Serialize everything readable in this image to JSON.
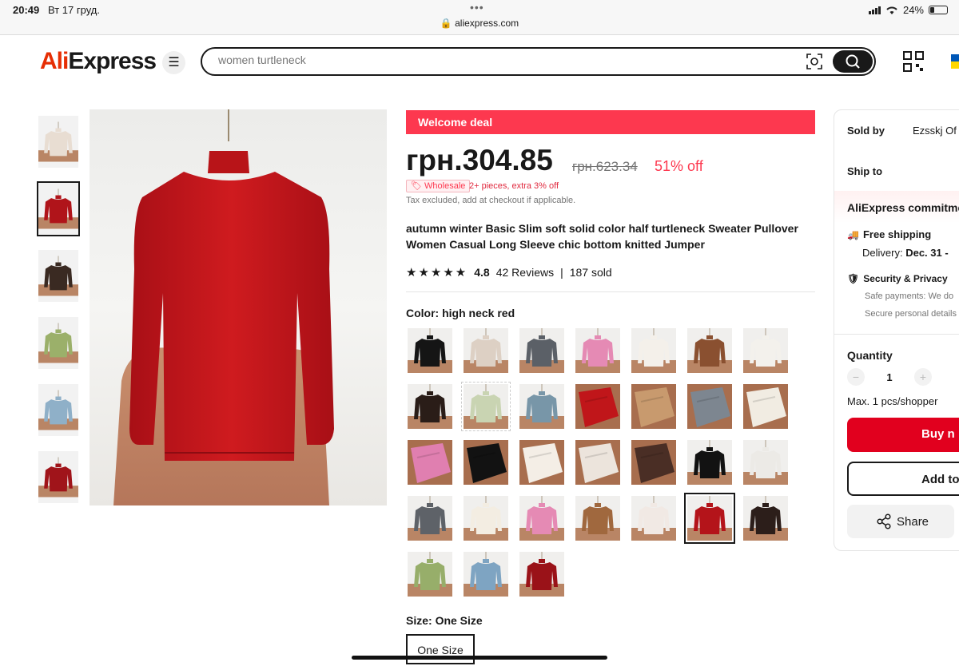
{
  "status_bar": {
    "time": "20:49",
    "date": "Вт 17 груд.",
    "dots": "•••",
    "url": "aliexpress.com",
    "battery": "24%",
    "battery_level": 0.24
  },
  "header": {
    "logo_part1": "Ali",
    "logo_part2": "Express",
    "search_placeholder": "women turtleneck"
  },
  "product": {
    "welcome_deal": "Welcome deal",
    "price": "грн.304.85",
    "old_price": "грн.623.34",
    "discount": "51% off",
    "wholesale_badge": "Wholesale",
    "wholesale_text": "2+ pieces, extra 3% off",
    "tax_note": "Tax excluded, add at checkout if applicable.",
    "title": "autumn winter Basic Slim soft solid color half turtleneck Sweater Pullover Women Casual Long Sleeve chic bottom knitted Jumper",
    "stars": "★★★★★",
    "rating": "4.8",
    "reviews": "42 Reviews",
    "sep": "|",
    "sold": "187 sold",
    "color_label": "Color: high neck red",
    "size_label": "Size: One Size",
    "size_option": "One Size"
  },
  "thumbnails": [
    {
      "color": "#e8ddd2"
    },
    {
      "color": "#b0141a",
      "selected": true
    },
    {
      "color": "#3a2a22"
    },
    {
      "color": "#9bb06a"
    },
    {
      "color": "#8fb0c8"
    },
    {
      "color": "#a0141a"
    }
  ],
  "swatches": [
    {
      "color": "#151515"
    },
    {
      "color": "#ddd0c4"
    },
    {
      "color": "#5b6067"
    },
    {
      "color": "#e58ab4"
    },
    {
      "color": "#f4f0ea"
    },
    {
      "color": "#8a5030"
    },
    {
      "color": "#f3f1ec"
    },
    {
      "color": "#2a1d18"
    },
    {
      "color": "#c9d4b2",
      "dashed": true
    },
    {
      "color": "#7896a8"
    },
    {
      "color": "#c0161a",
      "folded": true
    },
    {
      "color": "#c89a6e",
      "folded": true
    },
    {
      "color": "#7d8690",
      "folded": true
    },
    {
      "color": "#f1ece2",
      "folded": true
    },
    {
      "color": "#e07fb0",
      "folded": true
    },
    {
      "color": "#121212",
      "folded": true
    },
    {
      "color": "#f4eee6",
      "folded": true
    },
    {
      "color": "#ece4dc",
      "folded": true
    },
    {
      "color": "#4a2e25",
      "folded": true
    },
    {
      "color": "#121212"
    },
    {
      "color": "#eceae6"
    },
    {
      "color": "#5e6268"
    },
    {
      "color": "#f3ede2"
    },
    {
      "color": "#e58ab4"
    },
    {
      "color": "#a0683e"
    },
    {
      "color": "#f1e9e4"
    },
    {
      "color": "#b4141a",
      "selected": true
    },
    {
      "color": "#2c1e1a"
    },
    {
      "color": "#97ae6a"
    },
    {
      "color": "#7ea4c2"
    },
    {
      "color": "#9a1218"
    }
  ],
  "sidebar": {
    "sold_by_label": "Sold by",
    "sold_by_value": "Ezsskj Of",
    "ship_to_label": "Ship to",
    "commitment": "AliExpress commitme",
    "free_shipping": "Free shipping",
    "delivery_label": "Delivery:",
    "delivery_value": "Dec. 31 -",
    "security": "Security & Privacy",
    "safe_payments": "Safe payments: We do",
    "secure_details": "Secure personal details",
    "quantity_label": "Quantity",
    "qty_minus": "−",
    "qty_value": "1",
    "qty_plus": "+",
    "max_note": "Max. 1 pcs/shopper",
    "buy_label": "Buy n",
    "add_label": "Add to",
    "share_label": "Share"
  },
  "colors": {
    "accent_red": "#fd384f",
    "buy_red": "#e1001e",
    "logo_red": "#e62e04"
  }
}
